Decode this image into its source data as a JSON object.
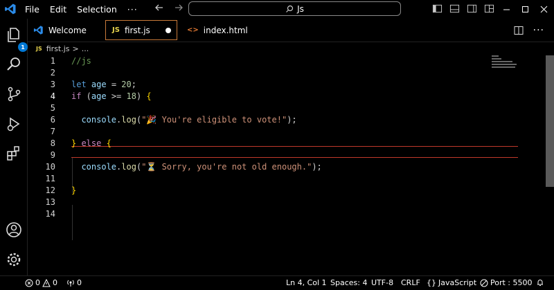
{
  "menu": {
    "file": "File",
    "edit": "Edit",
    "selection": "Selection",
    "more": "···"
  },
  "search": {
    "text": "Js"
  },
  "activity": {
    "explorer_badge": "1"
  },
  "tabs": [
    {
      "label": "Welcome",
      "icon": "vscode-icon"
    },
    {
      "label": "first.js",
      "icon_text": "JS",
      "modified": true
    },
    {
      "label": "index.html",
      "icon_text": "<>"
    }
  ],
  "breadcrumb": {
    "icon_text": "JS",
    "file": "first.js",
    "sep": ">",
    "more": "..."
  },
  "editor": {
    "line_numbers": [
      "1",
      "2",
      "3",
      "4",
      "5",
      "6",
      "7",
      "8",
      "9",
      "10",
      "11",
      "12",
      "13",
      "14"
    ],
    "current_line": "4",
    "lines": {
      "l1": "//js",
      "l3_kw": "let",
      "l3_var": "age",
      "l3_op": " = ",
      "l3_num": "20",
      "l3_end": ";",
      "l4_kw": "if",
      "l4_open": " (",
      "l4_var": "age",
      "l4_op": " >= ",
      "l4_num": "18",
      "l4_close": ") ",
      "l4_brace": "{",
      "l6_obj": "console",
      "l6_dot": ".",
      "l6_fn": "log",
      "l6_open": "(",
      "l6_str": "\"🎉 You're eligible to vote!\"",
      "l6_close": ");",
      "l8_brace1": "}",
      "l8_kw": " else ",
      "l8_brace2": "{",
      "l10_obj": "console",
      "l10_dot": ".",
      "l10_fn": "log",
      "l10_open": "(",
      "l10_str": "\"⏳ Sorry, you're not old enough.\"",
      "l10_close": ");",
      "l12_brace": "}"
    }
  },
  "status": {
    "errors": "0",
    "warnings": "0",
    "ports": "0",
    "position": "Ln 4, Col 1",
    "spaces": "Spaces: 4",
    "encoding": "UTF-8",
    "eol": "CRLF",
    "language": "JavaScript",
    "port": "Port : 5500"
  },
  "colors": {
    "accent": "#0078d4",
    "active_tab_border": "#c97a3a",
    "current_line_border": "#c0392b"
  }
}
